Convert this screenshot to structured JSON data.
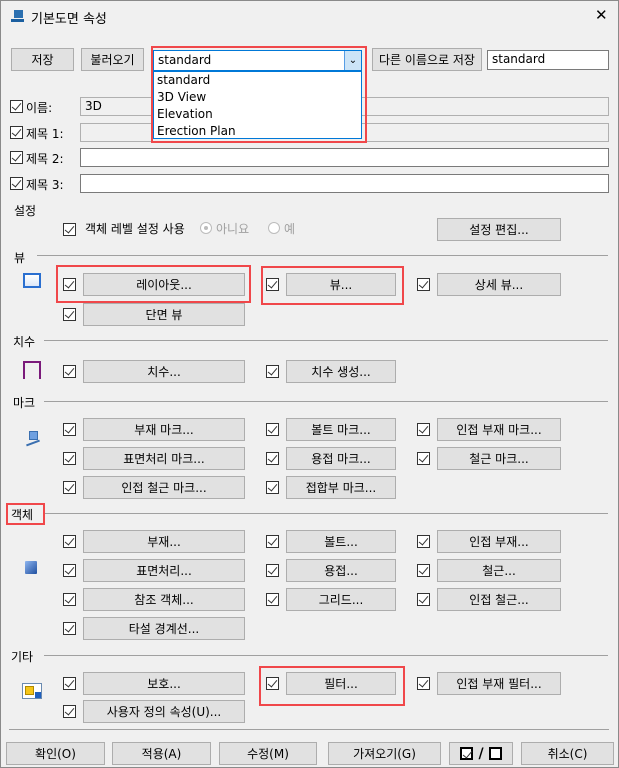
{
  "window": {
    "title": "기본도면 속성",
    "close": "✕"
  },
  "top": {
    "save": "저장",
    "load": "불러오기",
    "combo_value": "standard",
    "combo_options": [
      "standard",
      "3D View",
      "Elevation",
      "Erection Plan"
    ],
    "save_as": "다른 이름으로 저장",
    "save_as_name": "standard"
  },
  "fields": [
    {
      "label": "이름:",
      "value": "3D"
    },
    {
      "label": "제목 1:",
      "value": ""
    },
    {
      "label": "제목 2:",
      "value": ""
    },
    {
      "label": "제목 3:",
      "value": ""
    }
  ],
  "settings": {
    "header": "설정",
    "use_object_level": "객체 레벨 설정 사용",
    "no": "아니요",
    "yes": "예",
    "edit": "설정 편집..."
  },
  "view": {
    "header": "뷰",
    "layout": "레이아웃...",
    "view": "뷰...",
    "detail": "상세 뷰...",
    "section": "단면 뷰"
  },
  "dim": {
    "header": "치수",
    "dims": "치수...",
    "create": "치수 생성..."
  },
  "mark": {
    "header": "마크",
    "items": [
      "부재 마크...",
      "볼트 마크...",
      "인접 부재 마크...",
      "표면처리 마크...",
      "용접 마크...",
      "철근 마크...",
      "인접 철근 마크...",
      "접합부 마크..."
    ]
  },
  "objects": {
    "header": "객체",
    "items": [
      "부재...",
      "볼트...",
      "인접 부재...",
      "표면처리...",
      "용접...",
      "철근...",
      "참조 객체...",
      "그리드...",
      "인접 철근...",
      "타설 경계선..."
    ]
  },
  "other": {
    "header": "기타",
    "protect": "보호...",
    "filter": "필터...",
    "neighbor_filter": "인접 부재 필터...",
    "udas": "사용자 정의 속성(U)..."
  },
  "bottom": {
    "ok": "확인(O)",
    "apply": "적용(A)",
    "modify": "수정(M)",
    "get": "가져오기(G)",
    "toggle": "/",
    "cancel": "취소(C)"
  },
  "colors": {
    "highlight": "#f0474a",
    "selection": "#0078d7"
  }
}
